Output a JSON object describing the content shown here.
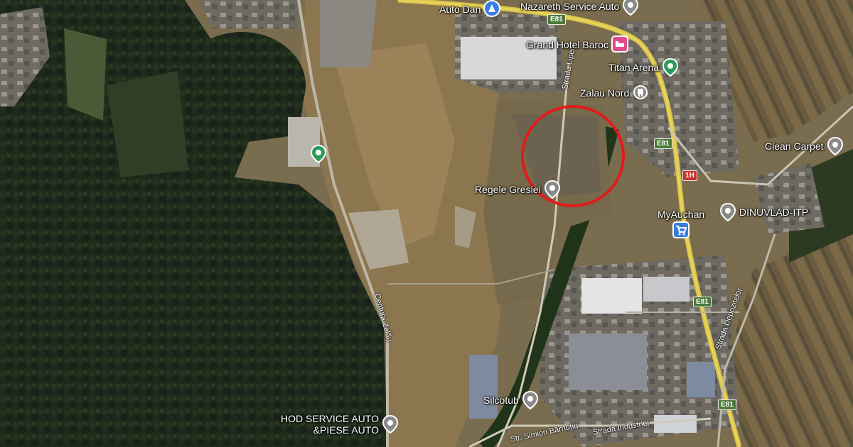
{
  "map": {
    "style": "satellite",
    "highlight_circle": {
      "color": "#e01c1c",
      "purpose": "area-of-interest"
    }
  },
  "pois": [
    {
      "id": "auto-dan",
      "label": "Auto Dan",
      "type": "gas-station",
      "color": "#3a7ee0"
    },
    {
      "id": "nazareth",
      "label": "Nazareth Service Auto",
      "type": "generic",
      "color": "#8a8a8a"
    },
    {
      "id": "grand-hotel",
      "label": "Grand Hotel Baroc",
      "type": "hotel",
      "color": "#e04b8f"
    },
    {
      "id": "titan-arena",
      "label": "Titan Arena",
      "type": "place",
      "color": "#2e9a5a"
    },
    {
      "id": "zalau-nord",
      "label": "Zalau Nord",
      "type": "train-station",
      "color": "#8a8a8a"
    },
    {
      "id": "clean-carpet",
      "label": "Clean Carpet",
      "type": "generic",
      "color": "#8a8a8a"
    },
    {
      "id": "regele-gresiei",
      "label": "Regele Gresiei",
      "type": "generic",
      "color": "#8a8a8a"
    },
    {
      "id": "myauchan",
      "label": "MyAuchan",
      "type": "shopping",
      "color": "#3a7ee0"
    },
    {
      "id": "dinuvlad",
      "label": "DINUVLAD-ITP",
      "type": "generic",
      "color": "#8a8a8a"
    },
    {
      "id": "silcotub",
      "label": "Silcotub",
      "type": "generic",
      "color": "#8a8a8a"
    },
    {
      "id": "hod-service",
      "label": "HOD SERVICE AUTO\n&PIESE AUTO",
      "type": "generic",
      "color": "#8a8a8a"
    },
    {
      "id": "green-pin",
      "label": "",
      "type": "place",
      "color": "#2e9a5a"
    }
  ],
  "roads": {
    "strada_lipei": "Strada Lipei",
    "centura_zalau": "Centura Zalău",
    "strada_depozitelor": "Strada Depozitelor",
    "str_simion_barnutiu": "Str. Simion Bărnuțiu",
    "strada_industriei": "Strada Industriei"
  },
  "shields": {
    "e81_top": "E81",
    "e81_mid": "E81",
    "e81_lower": "E81",
    "e81_bottom": "E81",
    "h1": "1H"
  }
}
